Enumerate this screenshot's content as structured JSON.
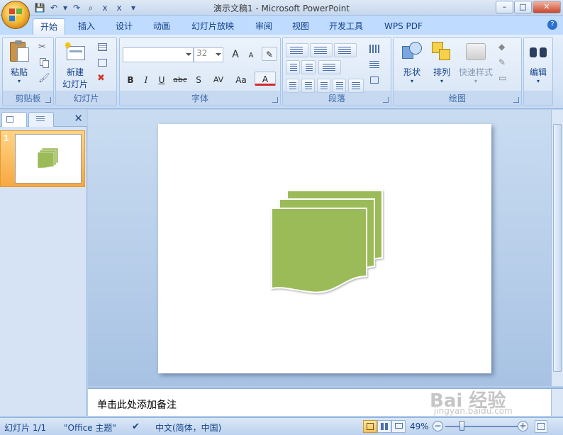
{
  "titlebar": {
    "title": "演示文稿1 - Microsoft PowerPoint",
    "minimize": "–",
    "maximize": "□",
    "close": "✕"
  },
  "quick_access": {
    "save": "💾",
    "undo": "↶",
    "undo_drop": "▾",
    "redo": "↷",
    "preview": "⌕",
    "extra1": "x",
    "extra2": "x",
    "customize": "▾"
  },
  "tabs": [
    {
      "label": "开始"
    },
    {
      "label": "插入"
    },
    {
      "label": "设计"
    },
    {
      "label": "动画"
    },
    {
      "label": "幻灯片放映"
    },
    {
      "label": "审阅"
    },
    {
      "label": "视图"
    },
    {
      "label": "开发工具"
    },
    {
      "label": "WPS PDF"
    }
  ],
  "help": "?",
  "ribbon": {
    "clipboard": {
      "label": "剪贴板",
      "paste": "粘贴"
    },
    "slides": {
      "label": "幻灯片",
      "new_slide_line1": "新建",
      "new_slide_line2": "幻灯片"
    },
    "font": {
      "label": "字体",
      "font_name": "",
      "font_size": "32",
      "bold": "B",
      "italic": "I",
      "underline": "U",
      "strike": "abc",
      "shadow": "S",
      "spacing": "AV",
      "case": "Aa",
      "color": "A",
      "grow": "A",
      "shrink": "A"
    },
    "paragraph": {
      "label": "段落"
    },
    "drawing": {
      "label": "绘图",
      "shapes": "形状",
      "arrange": "排列",
      "quick_styles": "快速样式"
    },
    "editing": {
      "label": "编辑"
    }
  },
  "leftpane": {
    "close": "✕",
    "slide_number": "1"
  },
  "notes": {
    "placeholder": "单击此处添加备注"
  },
  "statusbar": {
    "slide_count": "幻灯片 1/1",
    "theme": "\"Office 主题\"",
    "language": "中文(简体，中国)",
    "zoom": "49%",
    "zoom_out": "−",
    "zoom_in": "+"
  },
  "watermark": {
    "brand": "Bai 经验",
    "url": "jingyan.baidu.com"
  },
  "colors": {
    "shape_fill": "#9bbb59",
    "ribbon_bg": "#dce8f7",
    "accent": "#15428b"
  }
}
